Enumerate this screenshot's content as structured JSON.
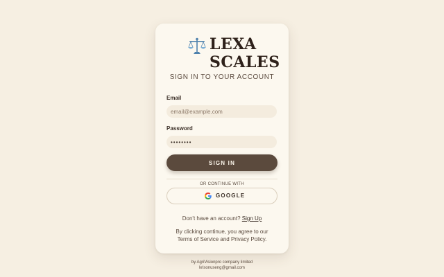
{
  "brand": {
    "line1": "LEXA",
    "line2": "SCALES",
    "icon": "scales-of-justice-icon"
  },
  "subtitle": "SIGN IN TO YOUR ACCOUNT",
  "form": {
    "email": {
      "label": "Email",
      "placeholder": "email@example.com",
      "value": ""
    },
    "password": {
      "label": "Password",
      "value": "••••••••"
    },
    "submit_label": "SIGN IN"
  },
  "divider_text": "OR CONTINUE WITH",
  "google_button": {
    "label": "GOOGLE",
    "icon": "google-icon"
  },
  "signup": {
    "prompt": "Don't have an account?",
    "link": "Sign Up"
  },
  "terms": {
    "prefix": "By clicking continue, you agree to our",
    "tos": "Terms of Service",
    "and": " and ",
    "privacy": "Privacy Policy",
    "suffix": "."
  },
  "footer": {
    "line1": "by AgriVisionpro company limited",
    "line2": "krisonuseng@gmail.com"
  },
  "colors": {
    "page_background": "#f6efe2",
    "card_background": "#fcf8ef",
    "input_background": "#f4ecde",
    "primary_button": "#5b4a3d",
    "text_dark": "#2e211a",
    "scale_icon": "#5a8fb8"
  }
}
